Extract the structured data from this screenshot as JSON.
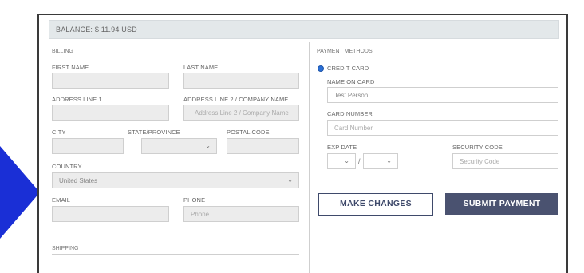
{
  "balance": {
    "text": "BALANCE: $ 11.94 USD"
  },
  "billing": {
    "section": "BILLING",
    "first_name": {
      "label": "FIRST NAME",
      "value": ""
    },
    "last_name": {
      "label": "LAST NAME",
      "value": ""
    },
    "address1": {
      "label": "ADDRESS LINE 1",
      "value": ""
    },
    "address2": {
      "label": "ADDRESS LINE 2 / COMPANY NAME",
      "placeholder": "Address Line 2 / Company Name"
    },
    "city": {
      "label": "CITY",
      "value": ""
    },
    "state": {
      "label": "STATE/PROVINCE",
      "value": ""
    },
    "postal": {
      "label": "POSTAL CODE",
      "value": ""
    },
    "country": {
      "label": "COUNTRY",
      "value": "United States"
    },
    "email": {
      "label": "EMAIL",
      "value": ""
    },
    "phone": {
      "label": "PHONE",
      "placeholder": "Phone"
    }
  },
  "shipping": {
    "section": "SHIPPING"
  },
  "payment": {
    "section": "PAYMENT METHODS",
    "method": "CREDIT CARD",
    "name_on_card": {
      "label": "NAME ON CARD",
      "value": "Test Person"
    },
    "card_number": {
      "label": "CARD NUMBER",
      "placeholder": "Card Number"
    },
    "exp_date": {
      "label": "EXP DATE",
      "separator": "/"
    },
    "security_code": {
      "label": "SECURITY CODE",
      "placeholder": "Security Code"
    }
  },
  "actions": {
    "make_changes": "MAKE CHANGES",
    "submit_payment": "SUBMIT PAYMENT"
  },
  "colors": {
    "arrow": "#1a2fd6",
    "button": "#4a5270",
    "radio": "#2a6fd6",
    "bar": "#e3e8ea"
  }
}
